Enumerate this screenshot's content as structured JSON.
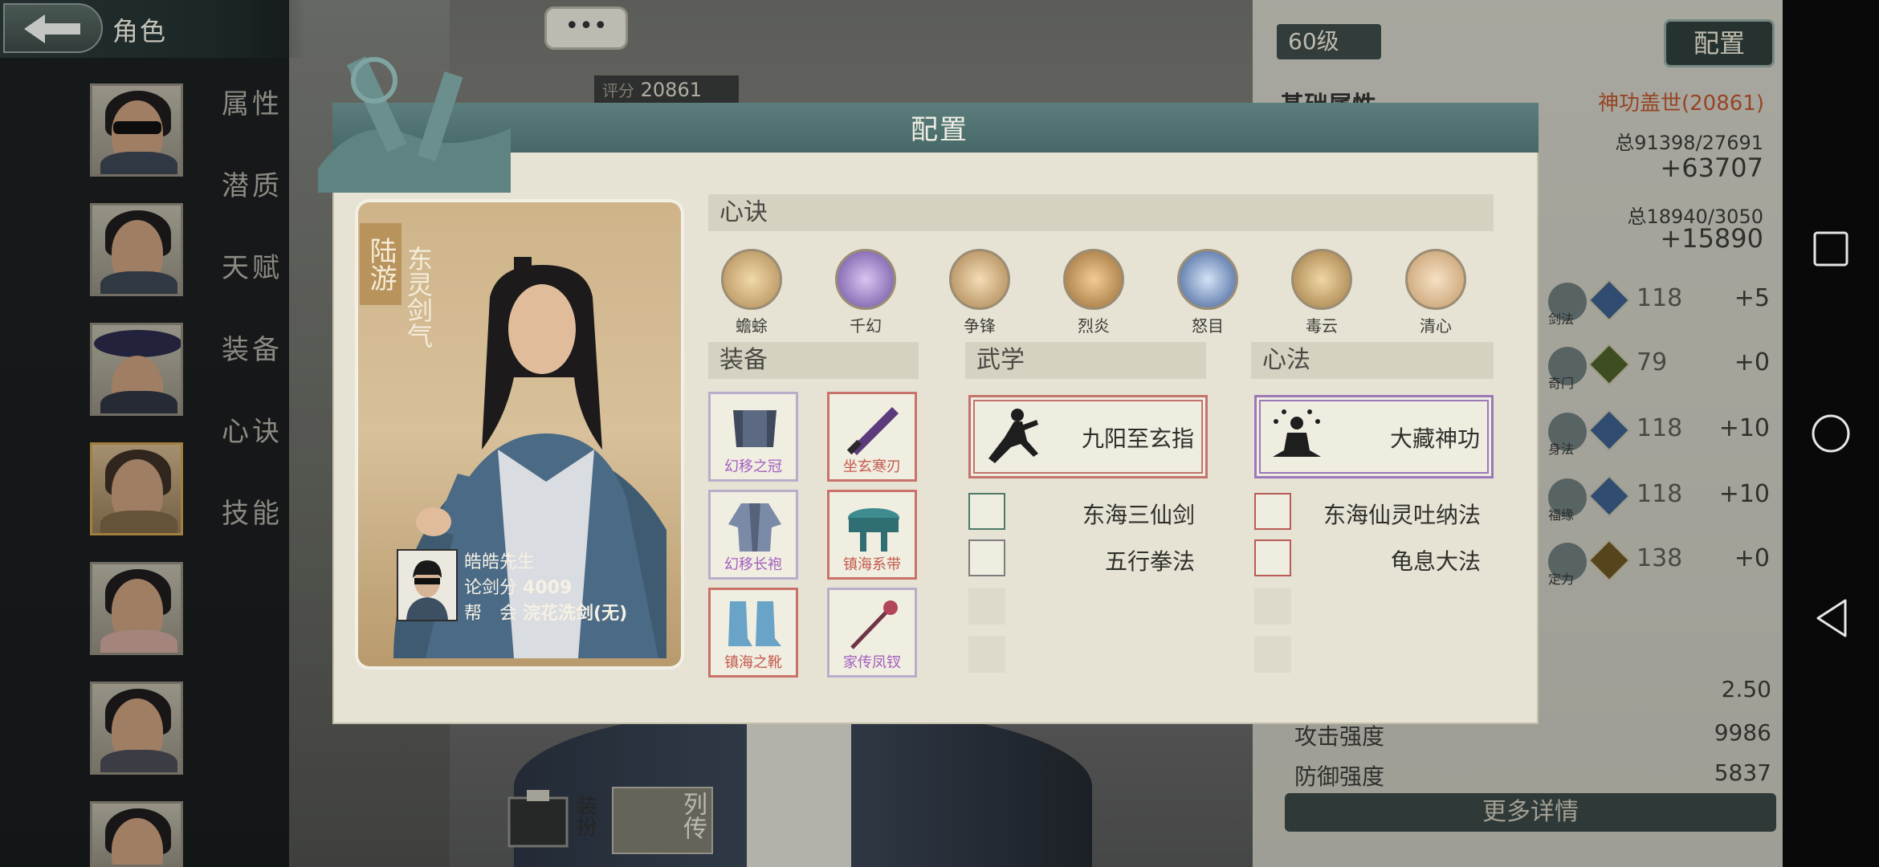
{
  "header": {
    "title": "角色",
    "chat_label": "•••",
    "score_label": "评分",
    "score_value": "20861"
  },
  "nav": {
    "items": [
      {
        "label": "属性"
      },
      {
        "label": "潜质"
      },
      {
        "label": "天赋"
      },
      {
        "label": "装备"
      },
      {
        "label": "心诀"
      },
      {
        "label": "技能"
      }
    ]
  },
  "right_panel": {
    "level": "60级",
    "config_button": "配置",
    "section_title": "基础属性",
    "section_note": "神功盖世(20861)",
    "total1": "总91398/27691",
    "total1_diff": "+63707",
    "total2": "总18940/3050",
    "total2_diff": "+15890",
    "stats": [
      {
        "label": "剑法",
        "gem": "乙",
        "value": "118",
        "plus": "+5"
      },
      {
        "label": "奇门",
        "gem": "丙",
        "value": "79",
        "plus": "+0"
      },
      {
        "label": "身法",
        "gem": "乙",
        "value": "118",
        "plus": "+10"
      },
      {
        "label": "福缘",
        "gem": "乙",
        "value": "118",
        "plus": "+10"
      },
      {
        "label": "定力",
        "gem": "甲",
        "value": "138",
        "plus": "+0"
      }
    ],
    "details": [
      {
        "label": "",
        "value": "2.50"
      },
      {
        "label": "攻击强度",
        "value": "9986"
      },
      {
        "label": "防御强度",
        "value": "5837"
      }
    ],
    "more_button": "更多详情"
  },
  "bottom": {
    "dress_label": "装扮",
    "bio_label": "列传"
  },
  "modal": {
    "title": "配置",
    "character": {
      "name": "陆游",
      "sect": "东灵剑气",
      "player_name": "皓皓先生",
      "duel_label": "论剑分",
      "duel_score": "4009",
      "guild_label": "帮　会",
      "guild_value": "浣花洗剑(无)"
    },
    "xinjue": {
      "header": "心诀",
      "skills": [
        {
          "name": "蟾蜍",
          "color": "#c8a979"
        },
        {
          "name": "千幻",
          "color": "#8a6fb8"
        },
        {
          "name": "争锋",
          "color": "#c9a272"
        },
        {
          "name": "烈炎",
          "color": "#c8955c"
        },
        {
          "name": "怒目",
          "color": "#5e7fb5"
        },
        {
          "name": "毒云",
          "color": "#c5a46a"
        },
        {
          "name": "清心",
          "color": "#d8b58a"
        }
      ]
    },
    "equipment": {
      "header": "装备",
      "items": [
        {
          "name": "幻移之冠",
          "rarity": "purple"
        },
        {
          "name": "坐玄寒刃",
          "rarity": "red"
        },
        {
          "name": "幻移长袍",
          "rarity": "purple"
        },
        {
          "name": "镇海系带",
          "rarity": "red"
        },
        {
          "name": "镇海之靴",
          "rarity": "red"
        },
        {
          "name": "家传凤钗",
          "rarity": "purple"
        }
      ]
    },
    "martial": {
      "header": "武学",
      "main": "九阳至玄指",
      "others": [
        "东海三仙剑",
        "五行拳法"
      ]
    },
    "inner": {
      "header": "心法",
      "main": "大藏神功",
      "others": [
        "东海仙灵吐纳法",
        "龟息大法"
      ]
    }
  },
  "system_nav": {
    "icons": [
      "square-icon",
      "circle-icon",
      "triangle-back-icon"
    ]
  }
}
